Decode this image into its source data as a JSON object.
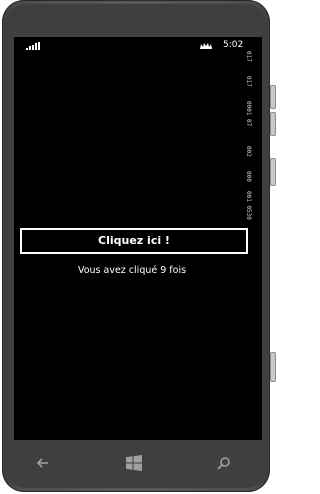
{
  "status_bar": {
    "time": "5:02",
    "signal_icon": "signal-bars-icon",
    "battery_icon": "battery-icon"
  },
  "debug_counters": [
    "017",
    "017",
    "0001 07",
    "002",
    "000",
    "001 0530"
  ],
  "main": {
    "button_label": "Cliquez ici !",
    "count_text": "Vous avez cliqué 9 fois"
  },
  "nav": {
    "back_icon": "back-arrow-icon",
    "start_icon": "windows-start-icon",
    "search_icon": "search-icon"
  },
  "colors": {
    "screen_background": "#000000",
    "foreground": "#ffffff",
    "chassis": "#4d4d4d"
  }
}
